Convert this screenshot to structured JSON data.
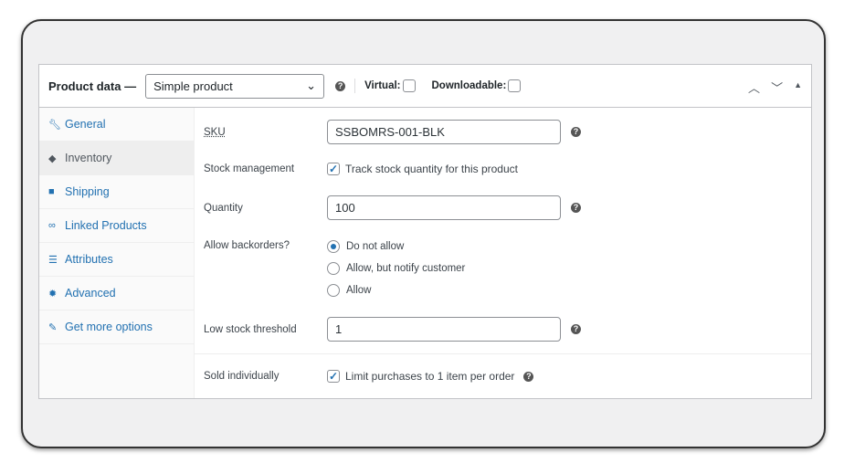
{
  "header": {
    "title": "Product data —",
    "product_type": "Simple product",
    "virtual_label": "Virtual:",
    "virtual_checked": false,
    "downloadable_label": "Downloadable:",
    "downloadable_checked": false
  },
  "sidebar": {
    "items": [
      {
        "label": "General",
        "icon": "wrench-icon"
      },
      {
        "label": "Inventory",
        "icon": "tag-icon",
        "active": true
      },
      {
        "label": "Shipping",
        "icon": "truck-icon"
      },
      {
        "label": "Linked Products",
        "icon": "link-icon"
      },
      {
        "label": "Attributes",
        "icon": "list-icon"
      },
      {
        "label": "Advanced",
        "icon": "gear-icon"
      },
      {
        "label": "Get more options",
        "icon": "plugin-icon"
      }
    ]
  },
  "fields": {
    "sku": {
      "label": "SKU",
      "value": "SSBOMRS-001-BLK"
    },
    "stock_management": {
      "label": "Stock management",
      "checkbox_label": "Track stock quantity for this product",
      "checked": true
    },
    "quantity": {
      "label": "Quantity",
      "value": "100"
    },
    "backorders": {
      "label": "Allow backorders?",
      "options": [
        "Do not allow",
        "Allow, but notify customer",
        "Allow"
      ],
      "selected": "Do not allow"
    },
    "low_stock": {
      "label": "Low stock threshold",
      "value": "1"
    },
    "sold_individually": {
      "label": "Sold individually",
      "checkbox_label": "Limit purchases to 1 item per order",
      "checked": true
    }
  },
  "colors": {
    "accent": "#2271b1"
  }
}
